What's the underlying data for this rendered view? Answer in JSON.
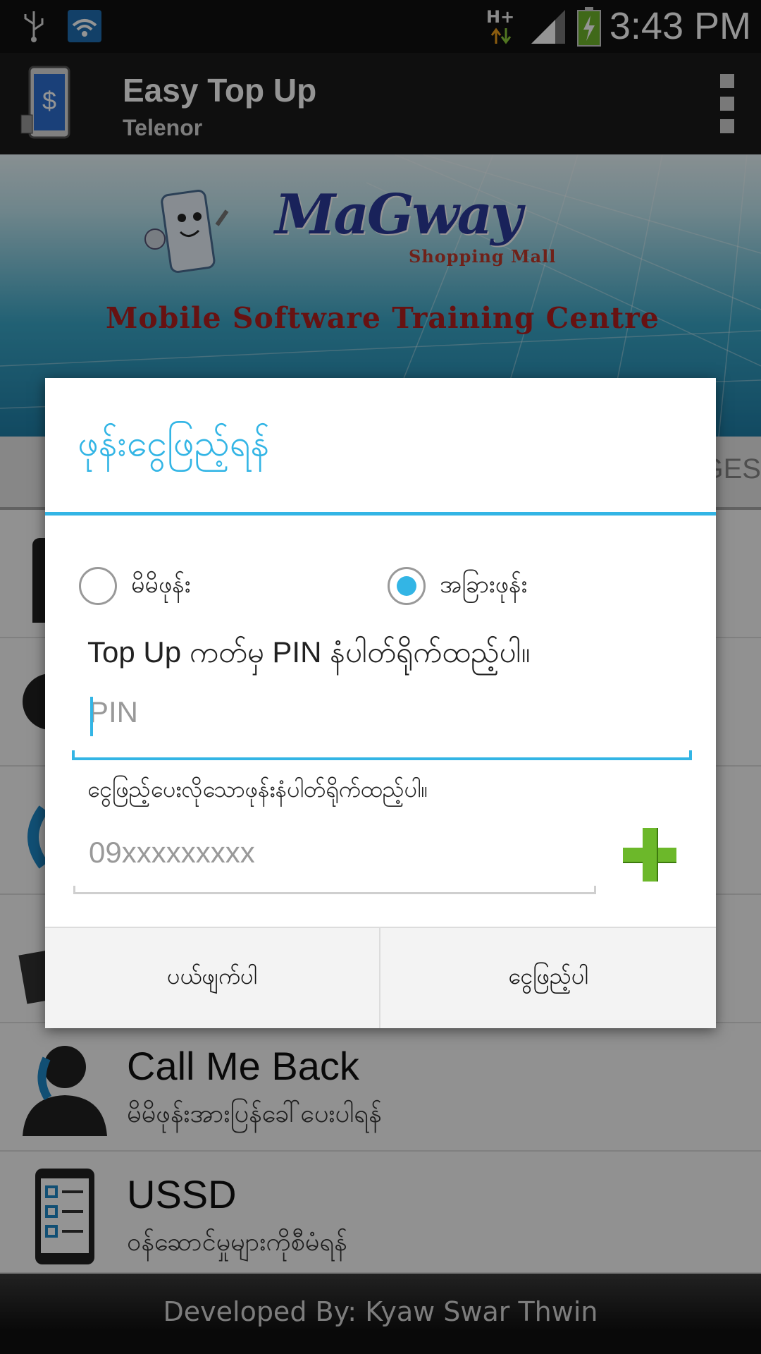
{
  "status_bar": {
    "time": "3:43 PM",
    "network": "H+",
    "icons": [
      "usb-icon",
      "wifi-icon",
      "data-arrows-icon",
      "signal-icon",
      "battery-charging-icon"
    ]
  },
  "app_bar": {
    "title": "Easy Top Up",
    "subtitle": "Telenor",
    "icons": [
      "app-logo-icon",
      "overflow-menu-icon"
    ]
  },
  "banner": {
    "logo_text": "MaGway",
    "mall_text": "Shopping Mall",
    "centre_text": "Mobile Software Training Centre"
  },
  "background": {
    "tab_partial": "GES",
    "list_items": [
      {
        "title": "Call Me Back",
        "subtitle": "မိမိဖုန်းအားပြန်ခေါ်ပေးပါရန်",
        "icon": "person-phone-icon"
      },
      {
        "title": "USSD",
        "subtitle": "ဝန်ဆောင်မှုများကိုစီမံရန်",
        "icon": "phone-checklist-icon"
      }
    ],
    "footer": "Developed By: Kyaw Swar Thwin"
  },
  "dialog": {
    "title": "ဖုန်းငွေဖြည့်ရန်",
    "radio_own": "မိမိဖုန်း",
    "radio_other": "အခြားဖုန်း",
    "selected": "other",
    "pin_label": "Top Up ကတ်မှ PIN နံပါတ်ရိုက်ထည့်ပါ။",
    "pin_placeholder": "PIN",
    "pin_value": "",
    "phone_label": "ငွေဖြည့်ပေးလိုသောဖုန်းနံပါတ်ရိုက်ထည့်ပါ။",
    "phone_placeholder": "09xxxxxxxxx",
    "phone_value": "",
    "cancel_label": "ပယ်ဖျက်ပါ",
    "confirm_label": "ငွေဖြည့်ပါ",
    "accent_color": "#33b5e5",
    "add_contact_color": "#6cb82a"
  }
}
